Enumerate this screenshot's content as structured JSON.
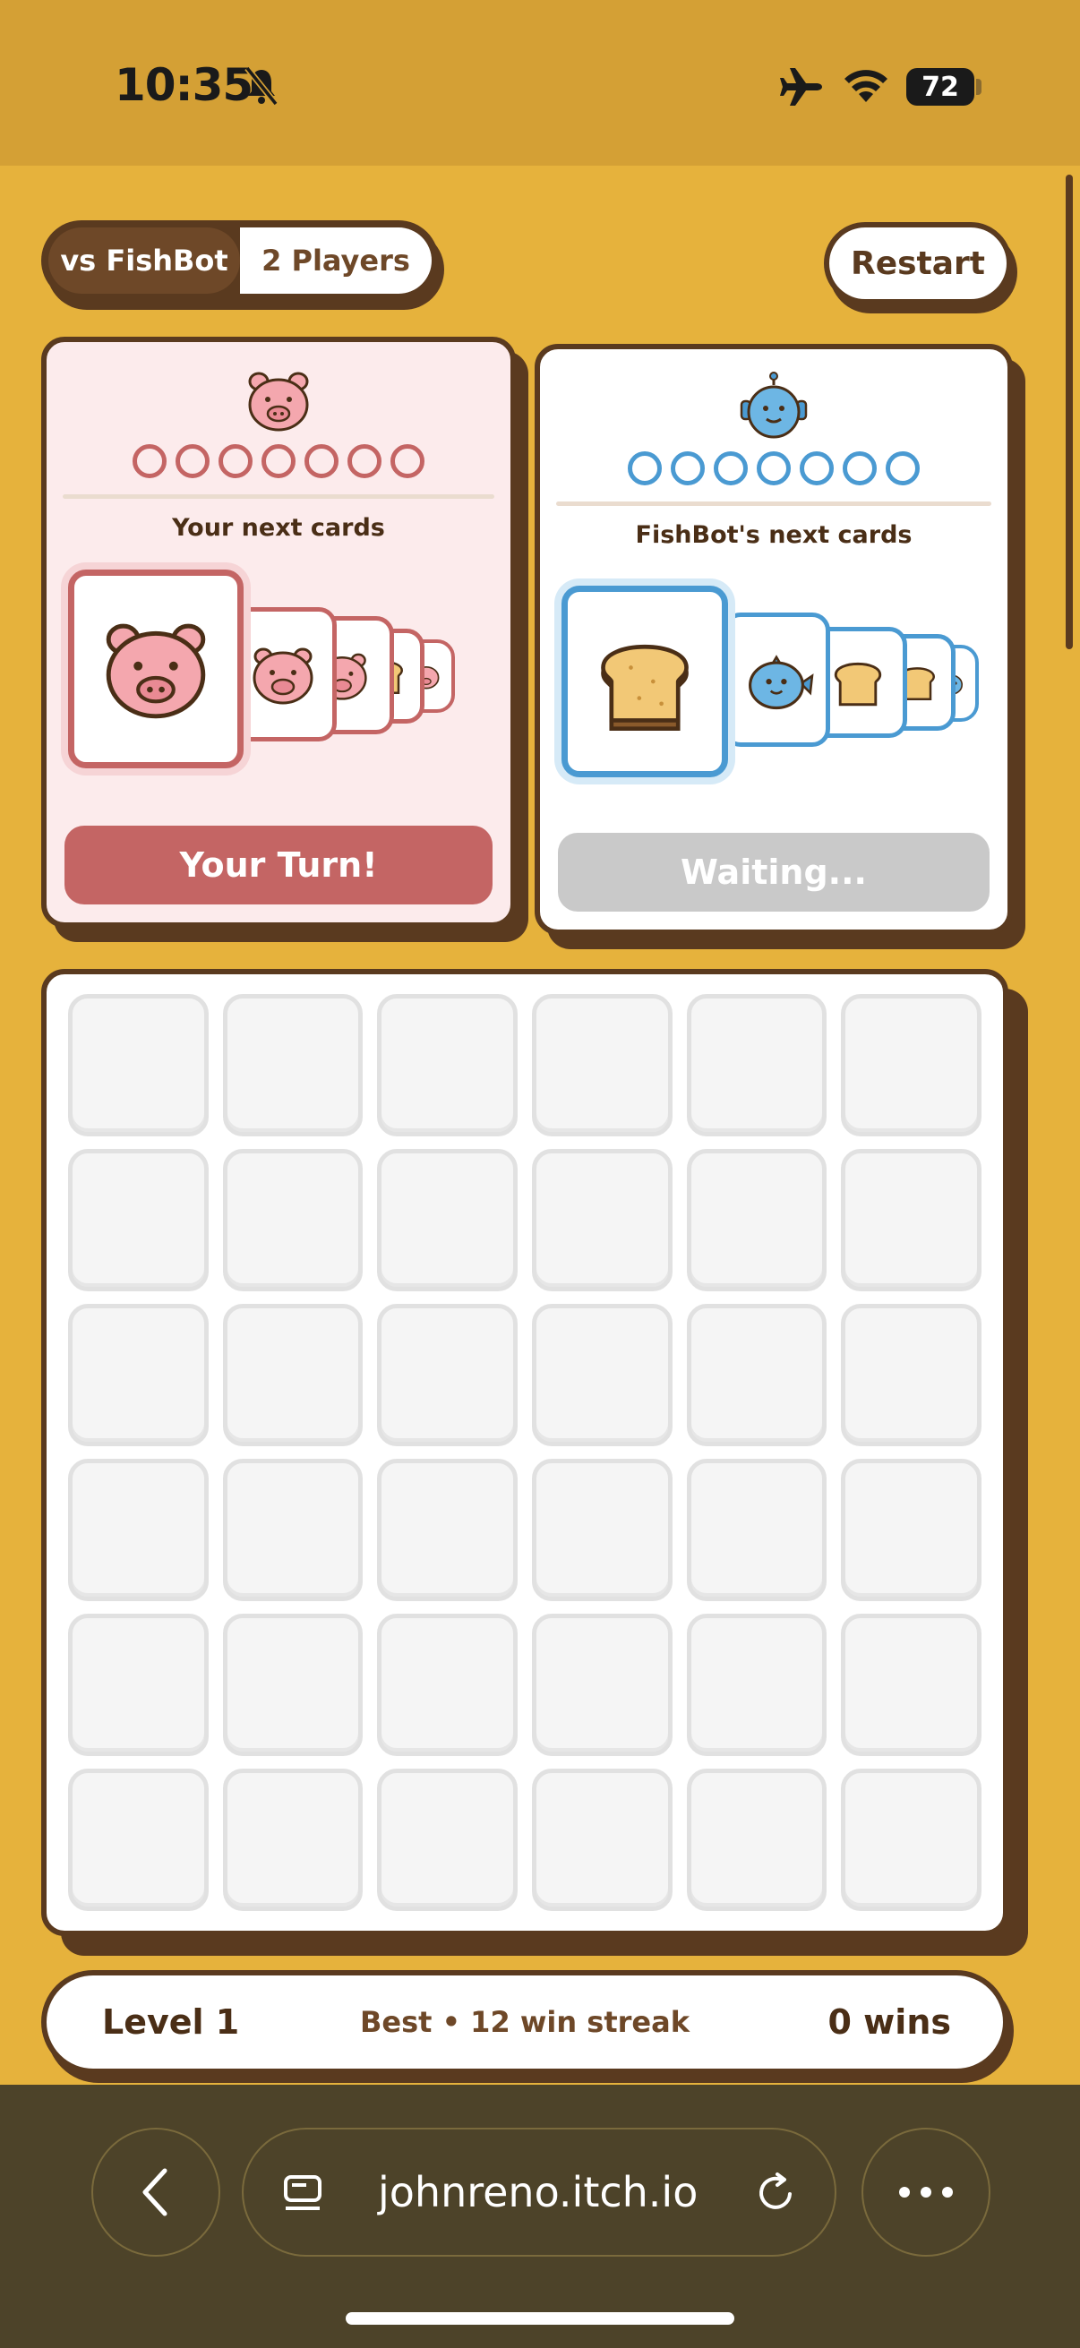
{
  "status_bar": {
    "time": "10:35",
    "battery": "72"
  },
  "mode_toggle": {
    "vs_bot_label": "vs FishBot",
    "two_players_label": "2 Players",
    "selected": "vs FishBot"
  },
  "restart_label": "Restart",
  "player": {
    "avatar": "pig-icon",
    "pip_count": 7,
    "next_cards_label": "Your next cards",
    "next_cards": [
      "pig",
      "pig",
      "pig",
      "toast",
      "pig"
    ],
    "turn_label": "Your Turn!",
    "color": "#C46564"
  },
  "bot": {
    "avatar": "fishbot-icon",
    "pip_count": 7,
    "next_cards_label": "FishBot's next cards",
    "next_cards": [
      "toast",
      "fish",
      "toast",
      "toast",
      "fish"
    ],
    "turn_label": "Waiting...",
    "color": "#4A9AD2"
  },
  "board": {
    "rows": 6,
    "cols": 6
  },
  "stats": {
    "level": "Level 1",
    "best": "Best • 12 win streak",
    "wins": "0 wins"
  },
  "browser": {
    "url": "johnreno.itch.io"
  },
  "colors": {
    "background": "#E6B23C",
    "outline": "#5A3A1F",
    "browser_bar": "#4D4329"
  }
}
